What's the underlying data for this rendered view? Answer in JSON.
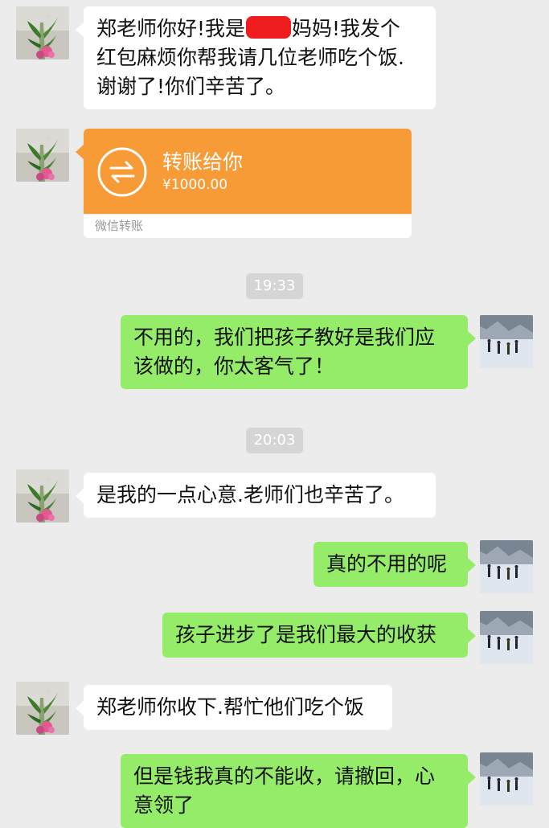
{
  "messages": [
    {
      "side": "left",
      "text_before": "郑老师你好!我是",
      "text_after": "妈妈!我发个\n红包麻烦你帮我请几位老师吃个饭.\n谢谢了!你们辛苦了。"
    },
    {
      "side": "left",
      "transfer": {
        "title": "转账给你",
        "amount": "¥1000.00",
        "footer": "微信转账"
      }
    },
    {
      "time": "19:33"
    },
    {
      "side": "right",
      "text": "不用的，我们把孩子教好是我们应\n该做的，你太客气了！"
    },
    {
      "time": "20:03"
    },
    {
      "side": "left",
      "text": "是我的一点心意.老师们也辛苦了。"
    },
    {
      "side": "right",
      "text": "真的不用的呢"
    },
    {
      "side": "right",
      "text": "孩子进步了是我们最大的收获"
    },
    {
      "side": "left",
      "text": "郑老师你收下.帮忙他们吃个饭"
    },
    {
      "side": "right",
      "text": "但是钱我真的不能收，请撤回，心\n意领了"
    }
  ],
  "icons": {
    "left_avatar": "flower-vase-avatar",
    "right_avatar": "snow-hikers-avatar",
    "transfer": "transfer-arrows-icon"
  },
  "colors": {
    "background": "#ececec",
    "outgoing": "#95ec69",
    "incoming": "#ffffff",
    "transfer": "#f79b37",
    "redaction": "#ef1d1d"
  }
}
